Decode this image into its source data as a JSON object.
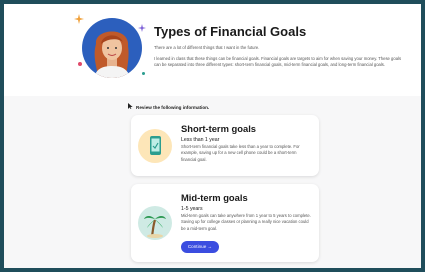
{
  "header": {
    "title": "Types of Financial Goals",
    "intro_line1": "There are a lot of different things that I want in the future.",
    "intro_line2": "I learned in class that these things can be financial goals. Financial goals are targets to aim for when saving your money. These goals can be separated into three different types: short-term financial goals, mid-term financial goals, and long-term financial goals."
  },
  "review_label": "Review the following information.",
  "cards": [
    {
      "title": "Short-term goals",
      "subtitle": "Less than 1 year",
      "description": "Short-term financial goals take less than a year to complete. For example, saving up for a new cell phone could be a short-term financial goal.",
      "icon": "phone-icon"
    },
    {
      "title": "Mid-term goals",
      "subtitle": "1-5 years",
      "description": "Mid-term goals can take anywhere from 1 year to 5 years to complete. Saving up for college classes or planning a really nice vacation could be a mid-term goal.",
      "icon": "palm-tree-icon"
    }
  ],
  "continue_label": "Continue →",
  "colors": {
    "accent": "#3b4de0",
    "frame": "#1f4d5b",
    "avatar_bg": "#2c5fbd"
  }
}
